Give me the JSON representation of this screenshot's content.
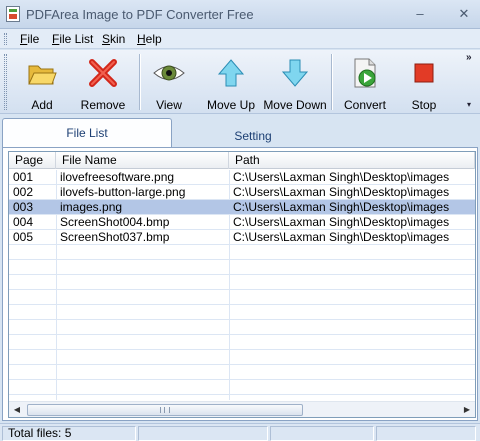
{
  "window": {
    "title": "PDFArea Image to PDF Converter Free",
    "minimize": "‒",
    "close": "✕"
  },
  "menu": [
    {
      "key": "F",
      "rest": "ile"
    },
    {
      "key": "F",
      "rest": "ile List"
    },
    {
      "key": "S",
      "rest": "kin"
    },
    {
      "key": "H",
      "rest": "elp"
    }
  ],
  "toolbar": {
    "add": "Add",
    "remove": "Remove",
    "view": "View",
    "move_up": "Move Up",
    "move_down": "Move Down",
    "convert": "Convert",
    "stop": "Stop",
    "overflow": "»",
    "overflow_arrow": "▾"
  },
  "tabs": {
    "file_list": "File List",
    "setting": "Setting"
  },
  "table": {
    "columns": [
      "Page",
      "File Name",
      "Path"
    ],
    "rows": [
      {
        "page": "001",
        "name": "ilovefreesoftware.png",
        "path": "C:\\Users\\Laxman Singh\\Desktop\\images"
      },
      {
        "page": "002",
        "name": "ilovefs-button-large.png",
        "path": "C:\\Users\\Laxman Singh\\Desktop\\images"
      },
      {
        "page": "003",
        "name": "images.png",
        "path": "C:\\Users\\Laxman Singh\\Desktop\\images"
      },
      {
        "page": "004",
        "name": "ScreenShot004.bmp",
        "path": "C:\\Users\\Laxman Singh\\Desktop\\images"
      },
      {
        "page": "005",
        "name": "ScreenShot037.bmp",
        "path": "C:\\Users\\Laxman Singh\\Desktop\\images"
      }
    ],
    "selected_row": "003"
  },
  "scrollbar": {
    "left": "◀",
    "right": "▶"
  },
  "status": {
    "total_files": "Total files: 5"
  },
  "colors": {
    "selection": "#b3c6e6",
    "accent": "#1c3f73"
  }
}
